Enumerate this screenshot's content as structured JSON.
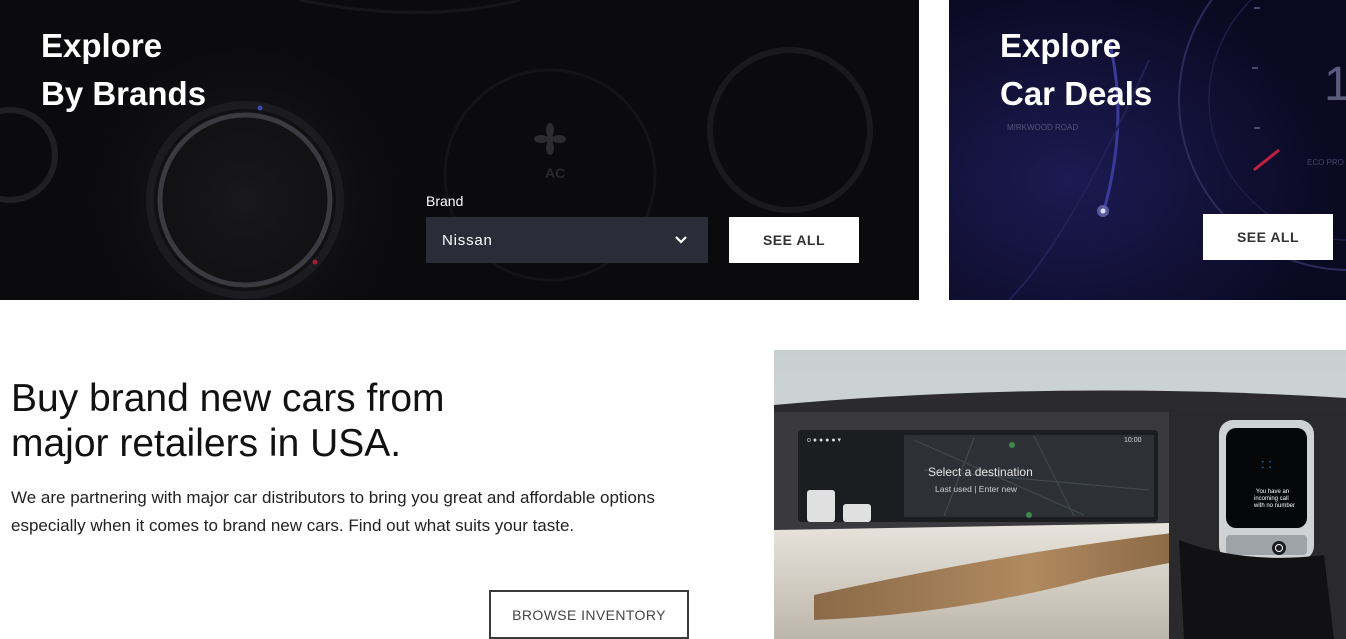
{
  "explore_brands": {
    "title_line1": "Explore",
    "title_line2": "By Brands",
    "brand_label": "Brand",
    "brand_selected": "Nissan",
    "see_all_label": "SEE ALL"
  },
  "explore_deals": {
    "title_line1": "Explore",
    "title_line2": "Car Deals",
    "see_all_label": "SEE ALL"
  },
  "promo": {
    "headline_line1": "Buy brand new cars from",
    "headline_line2": "major retailers in USA.",
    "description": "We are partnering with major car distributors to bring you great and affordable options especially when it comes to brand new cars. Find out what suits your taste.",
    "browse_label": "BROWSE INVENTORY"
  },
  "car_display": {
    "screen_text": "Select a destination",
    "screen_subtext": "Last used | Enter new",
    "screen_time": "10:00",
    "device_text": "You have an incoming call with no number"
  },
  "deals_dashboard": {
    "road_label": "MIRKWOOD ROAD",
    "eco_label": "ECO PRO",
    "digit": "1"
  },
  "colors": {
    "brands_bg": "#0b0b0d",
    "deals_bg": "#0e0c22",
    "select_bg": "#2a2c37",
    "button_bg": "#ffffff"
  },
  "icons": {
    "dropdown": "chevron-down-icon",
    "ac": "fan-icon"
  }
}
